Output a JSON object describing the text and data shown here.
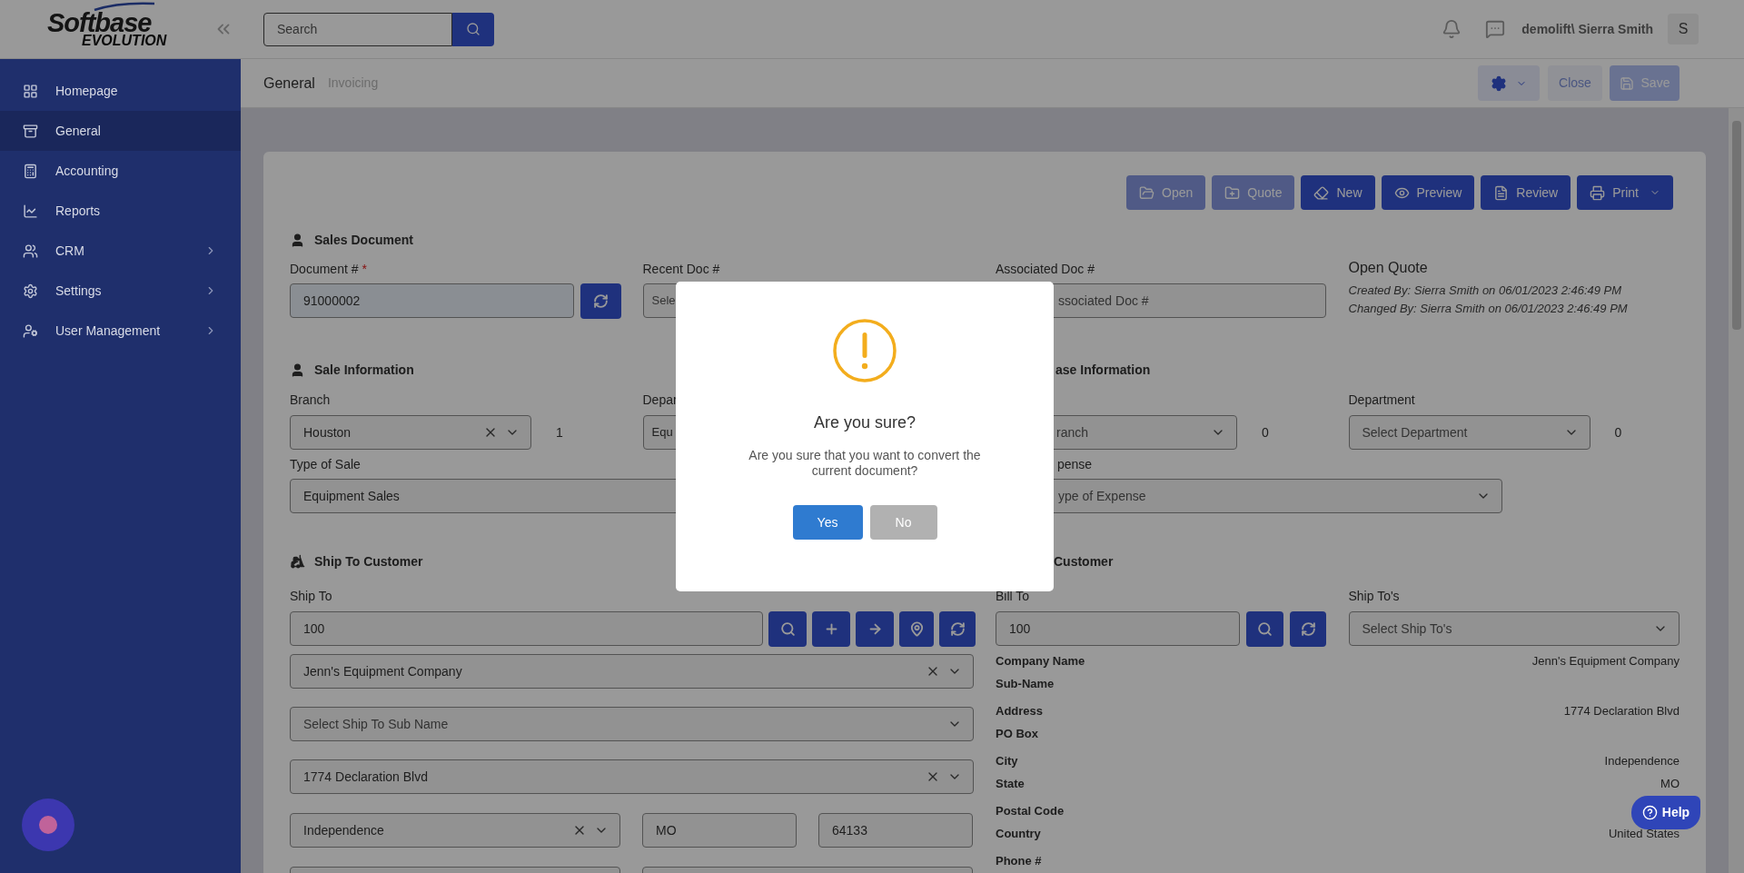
{
  "logo": {
    "brand": "Softbase",
    "product": "EVOLUTION"
  },
  "search": {
    "placeholder": "Search"
  },
  "user": {
    "name": "demolift\\ Sierra Smith",
    "initial": "S"
  },
  "sidebar": {
    "items": [
      {
        "label": "Homepage",
        "selected": false,
        "submenu": false
      },
      {
        "label": "General",
        "selected": true,
        "submenu": false
      },
      {
        "label": "Accounting",
        "selected": false,
        "submenu": false
      },
      {
        "label": "Reports",
        "selected": false,
        "submenu": false
      },
      {
        "label": "CRM",
        "selected": false,
        "submenu": true
      },
      {
        "label": "Settings",
        "selected": false,
        "submenu": true
      },
      {
        "label": "User Management",
        "selected": false,
        "submenu": true
      }
    ]
  },
  "tabs": [
    {
      "label": "General",
      "selected": true
    },
    {
      "label": "Invoicing",
      "selected": false
    }
  ],
  "header_actions": [
    {
      "kind": "settings",
      "disabled": true
    },
    {
      "kind": "close",
      "label": "Close",
      "disabled": true
    },
    {
      "kind": "save",
      "label": "Save",
      "disabled": true
    }
  ],
  "doc_actions": [
    {
      "label": "Open",
      "disabled": true,
      "dropdown": false
    },
    {
      "label": "Quote",
      "disabled": true,
      "dropdown": false
    },
    {
      "label": "New",
      "disabled": false,
      "dropdown": false
    },
    {
      "label": "Preview",
      "disabled": false,
      "dropdown": false
    },
    {
      "label": "Review",
      "disabled": false,
      "dropdown": false
    },
    {
      "label": "Print",
      "disabled": false,
      "dropdown": true
    }
  ],
  "sales_document": {
    "title": "Sales Document",
    "document_no": {
      "label": "Document #",
      "required_mark": "*",
      "value": "91000002"
    },
    "recent_doc": {
      "label": "Recent Doc #",
      "placeholder": "Sele"
    },
    "associated_doc": {
      "label": "Associated Doc #",
      "placeholder": "ssociated Doc #"
    },
    "status": {
      "title": "Open Quote",
      "created": "Created By: Sierra Smith on 06/01/2023 2:46:49 PM",
      "changed": "Changed By: Sierra Smith on 06/01/2023 2:46:49 PM"
    }
  },
  "sale_information": {
    "title": "Sale Information",
    "branch": {
      "label": "Branch",
      "value": "Houston",
      "clearable": true,
      "count": "1"
    },
    "department": {
      "label": "Depar",
      "value": "Equ"
    },
    "type_of_sale": {
      "label": "Type of Sale",
      "value": "Equipment Sales"
    }
  },
  "purchase_information": {
    "title": "ase Information",
    "branch": {
      "placeholder": "ranch",
      "count": "0"
    },
    "department": {
      "label": "Department",
      "placeholder": "Select Department",
      "count": "0"
    },
    "type_of_expense": {
      "label": "pense",
      "placeholder": "ype of Expense"
    }
  },
  "ship_to": {
    "title": "Ship To Customer",
    "label": "Ship To",
    "value": "100",
    "selects": [
      {
        "value": "Jenn's Equipment Company",
        "clearable": true
      },
      {
        "placeholder": "Select Ship To Sub Name",
        "clearable": false
      },
      {
        "value": "1774 Declaration Blvd",
        "clearable": true
      }
    ],
    "city": {
      "value": "Independence",
      "clearable": true
    },
    "state": "MO",
    "postal_code": "64133"
  },
  "bill_to": {
    "title": "Customer",
    "label": "Bill To",
    "value": "100",
    "ship_tos": {
      "label": "Ship To's",
      "placeholder": "Select Ship To's"
    },
    "details": [
      [
        {
          "label": "Company Name",
          "value": "Jenn's Equipment Company"
        },
        {
          "label": "Sub-Name"
        }
      ],
      [
        {
          "label": "Address",
          "value": "1774 Declaration Blvd"
        },
        {
          "label": "PO Box"
        }
      ],
      [
        {
          "label": "City",
          "value": "Independence"
        },
        {
          "label": "State",
          "value": "MO"
        }
      ],
      [
        {
          "label": "Postal Code"
        },
        {
          "label": "Country",
          "value": "United States"
        }
      ],
      [
        {
          "label": "Phone #"
        }
      ]
    ]
  },
  "dialog": {
    "title": "Are you sure?",
    "message": "Are you sure that you want to convert the current document?",
    "buttons": [
      {
        "label": "Yes",
        "kind": "primary"
      },
      {
        "label": "No",
        "kind": "secondary"
      }
    ]
  },
  "help": {
    "label": "Help"
  }
}
